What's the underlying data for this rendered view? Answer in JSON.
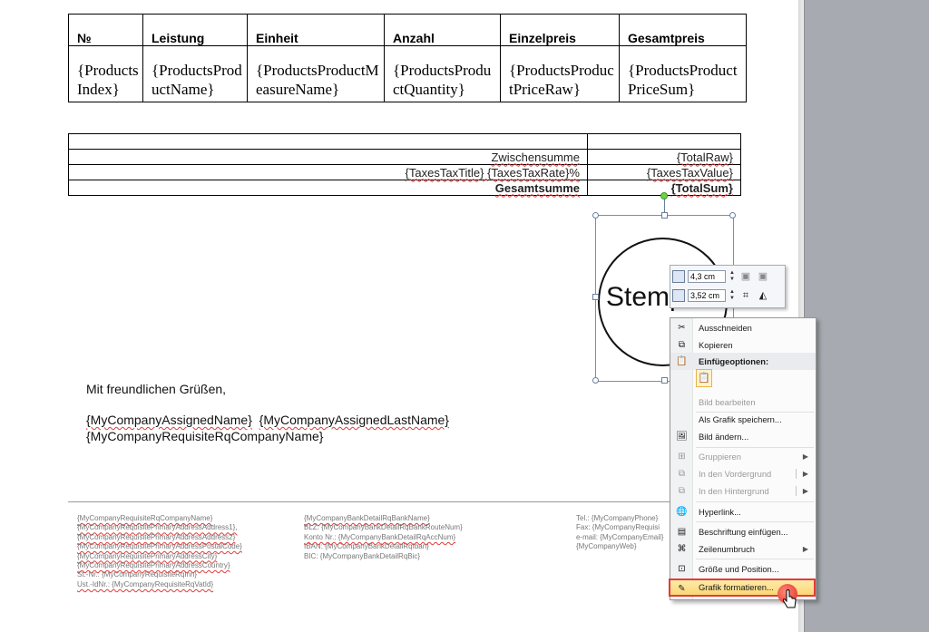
{
  "items_table": {
    "headers": [
      "№",
      "Leistung",
      "Einheit",
      "Anzahl",
      "Einzelpreis",
      "Gesamtpreis"
    ],
    "row": [
      "{ProductsIndex}",
      "{ProductsProductName}",
      "{ProductsProductMeasureName}",
      "{ProductsProductQuantity}",
      "{ProductsProductPriceRaw}",
      "{ProductsProductPriceSum}"
    ]
  },
  "totals": {
    "subtotal_label": "Zwischensumme",
    "subtotal_value": "{TotalRaw}",
    "tax_label": "{TaxesTaxTitle} {TaxesTaxRate}%",
    "tax_value": "{TaxesTaxValue}",
    "total_label": "Gesamtsumme",
    "total_value": "{TotalSum}"
  },
  "stamp": {
    "text": "Stempel"
  },
  "letter": {
    "closing": "Mit freundlichen  Grüßen,",
    "assigned_name": "{MyCompanyAssignedName}",
    "assigned_last_name": "{MyCompanyAssignedLastName}",
    "company_name": "{MyCompanyRequisiteRqCompanyName}"
  },
  "footer": {
    "col1": [
      "{MyCompanyRequisiteRqCompanyName}",
      "{MyCompanyRequisitePrimaryAddressAddress1},",
      "{MyCompanyRequisitePrimaryAddressAddress2}",
      "{MyCompanyRequisitePrimaryAddressPostalCode}",
      "{MyCompanyRequisitePrimaryAddressCity}",
      "{MyCompanyRequisitePrimaryAddressCountry}",
      "St.-Nr.: {MyCompanyRequisiteRqInn}",
      "Ust.-IdNr.: {MyCompanyRequisiteRqVatId}"
    ],
    "col2": [
      "{MyCompanyBankDetailRqBankName}",
      "BLZ: {MyCompanyBankDetailRqBankRouteNum}",
      "Konto Nr.: {MyCompanyBankDetailRqAccNum}",
      "IBAN: {MyCompanyBankDetailRqIban}",
      "BIC: {MyCompanyBankDetailRqBic}"
    ],
    "col3": [
      "Tel.: {MyCompanyPhone}",
      "Fax: {MyCompanyRequisi",
      "e-mail: {MyCompanyEmail}",
      "{MyCompanyWeb}"
    ]
  },
  "mini_toolbar": {
    "height_value": "4,3  cm",
    "width_value": "3,52  cm"
  },
  "context_menu": {
    "cut": "Ausschneiden",
    "copy": "Kopieren",
    "paste_options_header": "Einfügeoptionen:",
    "edit_picture": "Bild bearbeiten",
    "save_as_picture": "Als Grafik speichern...",
    "change_picture": "Bild ändern...",
    "group": "Gruppieren",
    "bring_to_front": "In den Vordergrund",
    "send_to_back": "In den Hintergrund",
    "hyperlink": "Hyperlink...",
    "insert_caption": "Beschriftung einfügen...",
    "wrap_text": "Zeilenumbruch",
    "size_position": "Größe und Position...",
    "format_picture": "Grafik formatieren..."
  },
  "colors": {
    "highlight_border": "#e23b3b",
    "highlight_fill": "#fbd776",
    "spell_underline": "#e03a3a"
  }
}
